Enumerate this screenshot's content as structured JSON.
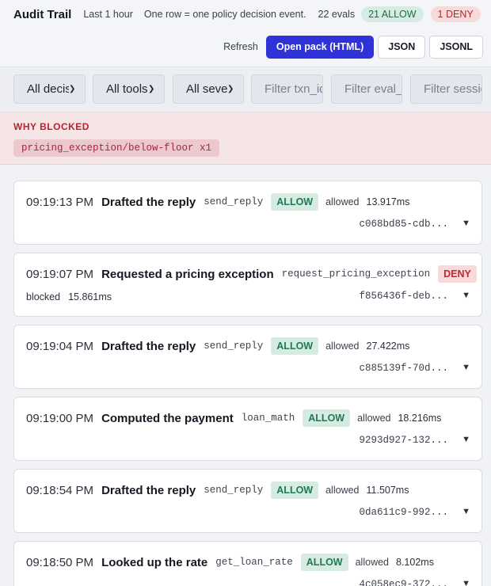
{
  "header": {
    "title": "Audit Trail",
    "range": "Last 1 hour",
    "description": "One row = one policy decision event.",
    "evals": "22 evals",
    "allow_count": "21 ALLOW",
    "deny_count": "1 DENY",
    "refresh": "Refresh",
    "open_pack": "Open pack (HTML)",
    "json": "JSON",
    "jsonl": "JSONL"
  },
  "filters": {
    "decisions": "All decisions",
    "tools": "All tools",
    "severity": "All severity",
    "txn_placeholder": "Filter txn_id",
    "eval_placeholder": "Filter eval_id",
    "session_placeholder": "Filter session"
  },
  "blocked": {
    "title": "WHY BLOCKED",
    "reason": "pricing_exception/below-floor x1"
  },
  "events": [
    {
      "time": "09:19:13 PM",
      "title": "Drafted the reply",
      "tool": "send_reply",
      "decision": "ALLOW",
      "status": "allowed",
      "latency": "13.917ms",
      "hash": "c068bd85-cdb..."
    },
    {
      "time": "09:19:07 PM",
      "title": "Requested a pricing exception",
      "tool": "request_pricing_exception",
      "decision": "DENY",
      "status": "blocked",
      "latency": "15.861ms",
      "hash": "f856436f-deb..."
    },
    {
      "time": "09:19:04 PM",
      "title": "Drafted the reply",
      "tool": "send_reply",
      "decision": "ALLOW",
      "status": "allowed",
      "latency": "27.422ms",
      "hash": "c885139f-70d..."
    },
    {
      "time": "09:19:00 PM",
      "title": "Computed the payment",
      "tool": "loan_math",
      "decision": "ALLOW",
      "status": "allowed",
      "latency": "18.216ms",
      "hash": "9293d927-132..."
    },
    {
      "time": "09:18:54 PM",
      "title": "Drafted the reply",
      "tool": "send_reply",
      "decision": "ALLOW",
      "status": "allowed",
      "latency": "11.507ms",
      "hash": "0da611c9-992..."
    },
    {
      "time": "09:18:50 PM",
      "title": "Looked up the rate",
      "tool": "get_loan_rate",
      "decision": "ALLOW",
      "status": "allowed",
      "latency": "8.102ms",
      "hash": "4c058ec9-372..."
    }
  ],
  "icons": {
    "expand": "triangle-down-icon",
    "select": "chevron-down-icon"
  },
  "colors": {
    "primary": "#2e32d8",
    "allow": "#1f7a52",
    "deny": "#c0282e",
    "blocked_bg": "#f5e5e7"
  }
}
